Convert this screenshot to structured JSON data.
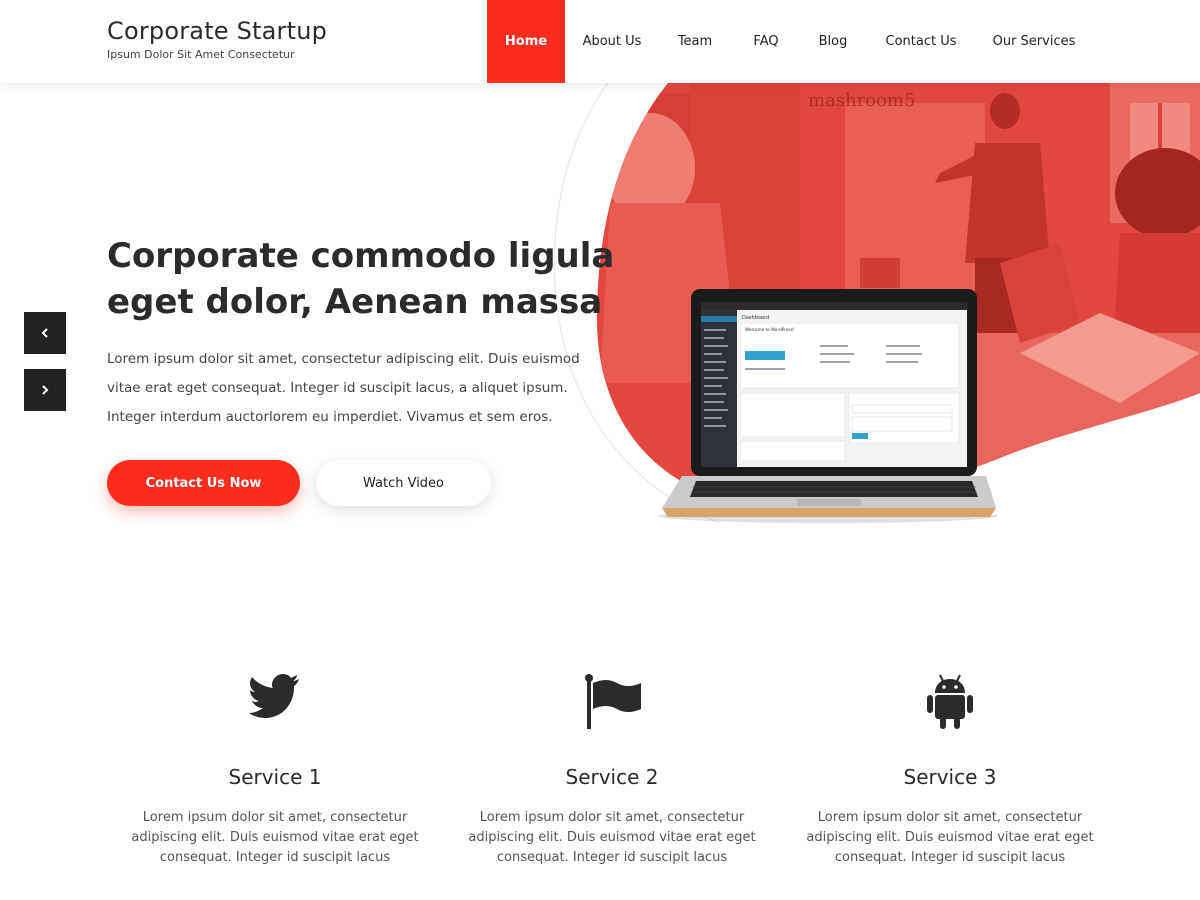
{
  "header": {
    "brand_title": "Corporate Startup",
    "brand_tagline": "Ipsum Dolor Sit Amet Consectetur",
    "nav": [
      {
        "label": "Home",
        "active": true
      },
      {
        "label": "About Us"
      },
      {
        "label": "Team"
      },
      {
        "label": "FAQ"
      },
      {
        "label": "Blog"
      },
      {
        "label": "Contact Us"
      },
      {
        "label": "Our Services"
      }
    ]
  },
  "hero": {
    "heading_lines": [
      "Corporate commodo ligula",
      "eget dolor, Aenean massa"
    ],
    "text_lines": [
      "Lorem ipsum dolor sit amet, consectetur adipiscing elit. Duis euismod",
      "vitae erat eget consequat. Integer id suscipit lacus, a aliquet ipsum.",
      "Integer interdum auctorlorem eu imperdiet. Vivamus et sem eros."
    ],
    "primary_button": "Contact Us Now",
    "secondary_button": "Watch Video",
    "photo_sign_text": "mashroom5",
    "screen_title": "Dashboard",
    "screen_welcome": "Welcome to WordPress!"
  },
  "services": [
    {
      "icon": "twitter-icon",
      "title": "Service 1",
      "desc_lines": [
        "Lorem ipsum dolor sit amet, consectetur",
        "adipiscing elit. Duis euismod vitae erat eget",
        "consequat. Integer id suscipit lacus"
      ]
    },
    {
      "icon": "flag-icon",
      "title": "Service 2",
      "desc_lines": [
        "Lorem ipsum dolor sit amet, consectetur",
        "adipiscing elit. Duis euismod vitae erat eget",
        "consequat. Integer id suscipit lacus"
      ]
    },
    {
      "icon": "android-icon",
      "title": "Service 3",
      "desc_lines": [
        "Lorem ipsum dolor sit amet, consectetur",
        "adipiscing elit. Duis euismod vitae erat eget",
        "consequat. Integer id suscipit lacus"
      ]
    }
  ],
  "colors": {
    "accent": "#fd2d1e",
    "hero_photo_tint": "#e2483f",
    "dark": "#222222",
    "text": "#444444"
  }
}
